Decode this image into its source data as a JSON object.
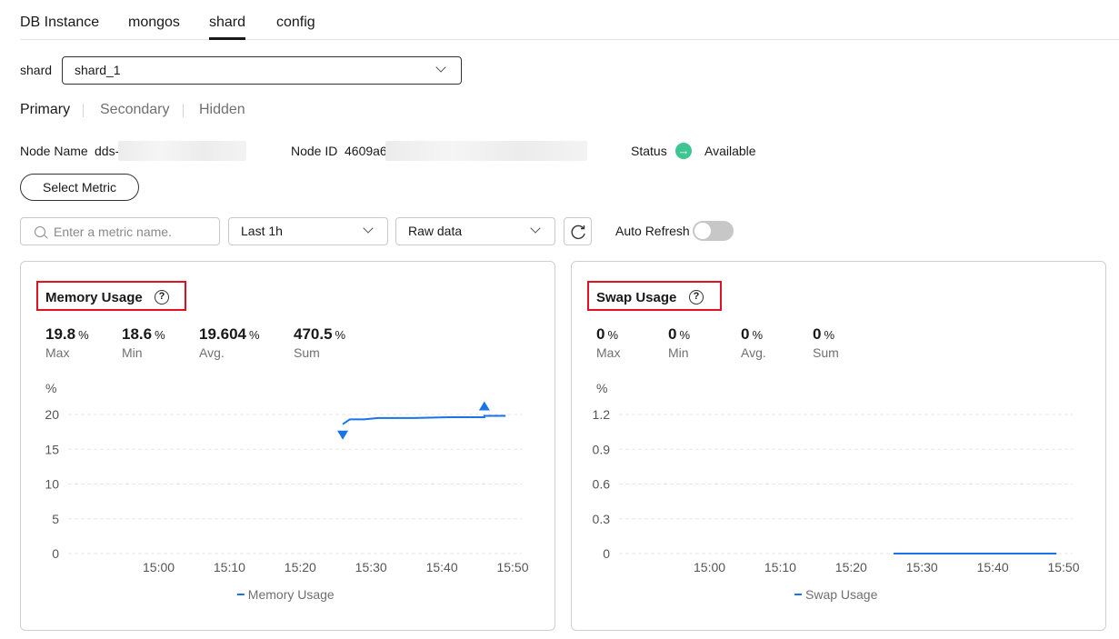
{
  "tabs": [
    "DB Instance",
    "mongos",
    "shard",
    "config"
  ],
  "active_tab": "shard",
  "shard_select": {
    "label": "shard",
    "value": "shard_1"
  },
  "roles": [
    "Primary",
    "Secondary",
    "Hidden"
  ],
  "node": {
    "name_label": "Node Name",
    "name_value": "dds-",
    "id_label": "Node ID",
    "id_value": "4609a6",
    "status_label": "Status",
    "status_value": "Available",
    "status_icon": "arrow-right-circle-icon"
  },
  "select_metric_label": "Select Metric",
  "search": {
    "placeholder": "Enter a metric name."
  },
  "time_range": "Last 1h",
  "data_type": "Raw data",
  "auto_refresh": {
    "label": "Auto Refresh",
    "enabled": false
  },
  "colors": {
    "series": "#1a73e8",
    "highlight_border": "#e0121f",
    "status": "#3ec692"
  },
  "cards": [
    {
      "title": "Memory Usage",
      "stats": [
        {
          "value": "19.8",
          "unit": "%",
          "label": "Max"
        },
        {
          "value": "18.6",
          "unit": "%",
          "label": "Min"
        },
        {
          "value": "19.604",
          "unit": "%",
          "label": "Avg."
        },
        {
          "value": "470.5",
          "unit": "%",
          "label": "Sum"
        }
      ]
    },
    {
      "title": "Swap Usage",
      "stats": [
        {
          "value": "0",
          "unit": "%",
          "label": "Max"
        },
        {
          "value": "0",
          "unit": "%",
          "label": "Min"
        },
        {
          "value": "0",
          "unit": "%",
          "label": "Avg."
        },
        {
          "value": "0",
          "unit": "%",
          "label": "Sum"
        }
      ]
    }
  ],
  "chart_data": [
    {
      "type": "line",
      "title": "Memory Usage",
      "ylabel": "%",
      "y_ticks": [
        "0",
        "5",
        "10",
        "15",
        "20"
      ],
      "ylim": [
        0,
        20
      ],
      "x_ticks": [
        "15:00",
        "15:10",
        "15:20",
        "15:30",
        "15:40",
        "15:50"
      ],
      "xlim": [
        "14:53",
        "15:50"
      ],
      "series": [
        {
          "name": "Memory Usage",
          "x": [
            "15:26",
            "15:27",
            "15:29",
            "15:31",
            "15:36",
            "15:41",
            "15:46",
            "15:46",
            "15:49"
          ],
          "y": [
            18.6,
            19.3,
            19.3,
            19.5,
            19.5,
            19.6,
            19.6,
            19.8,
            19.8
          ]
        }
      ],
      "markers": [
        {
          "type": "min",
          "x": "15:26",
          "y": 18.6
        },
        {
          "type": "max",
          "x": "15:46",
          "y": 19.8
        }
      ],
      "grid": true,
      "legend": "bottom-center"
    },
    {
      "type": "line",
      "title": "Swap Usage",
      "ylabel": "%",
      "y_ticks": [
        "0",
        "0.3",
        "0.6",
        "0.9",
        "1.2"
      ],
      "ylim": [
        0,
        1.2
      ],
      "x_ticks": [
        "15:00",
        "15:10",
        "15:20",
        "15:30",
        "15:40",
        "15:50"
      ],
      "xlim": [
        "14:53",
        "15:50"
      ],
      "series": [
        {
          "name": "Swap Usage",
          "x": [
            "15:26",
            "15:49"
          ],
          "y": [
            0,
            0
          ]
        }
      ],
      "grid": true,
      "legend": "bottom-center"
    }
  ]
}
